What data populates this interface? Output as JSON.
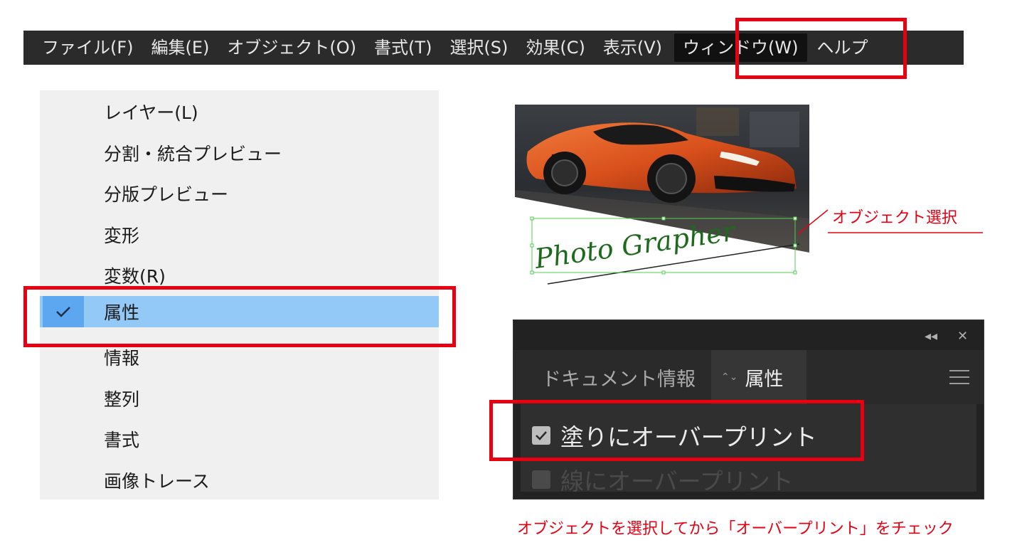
{
  "menubar": {
    "items": [
      "ファイル(F)",
      "編集(E)",
      "オブジェクト(O)",
      "書式(T)",
      "選択(S)",
      "効果(C)",
      "表示(V)",
      "ウィンドウ(W)",
      "ヘルプ"
    ],
    "active_index": 7
  },
  "window_menu": {
    "items": [
      "レイヤー(L)",
      "分割・統合プレビュー",
      "分版プレビュー",
      "変形",
      "変数(R)",
      "属性",
      "情報",
      "整列",
      "書式",
      "画像トレース"
    ],
    "checked_item": "属性",
    "check_icon": "checkmark-icon"
  },
  "artwork": {
    "photo_text": "Photo Grapher",
    "object_label": "オブジェクト選択"
  },
  "attributes_panel": {
    "collapse_glyph": "◂◂",
    "close_glyph": "✕",
    "tab_inactive": "ドキュメント情報",
    "tab_active_arrows": "⌃⌄",
    "tab_active": "属性",
    "menu_icon": "hamburger-icon",
    "overprint_fill": {
      "label": "塗りにオーバープリント",
      "checked": true
    },
    "overprint_stroke": {
      "label": "線にオーバープリント",
      "checked": false
    }
  },
  "footnote": "オブジェクトを選択してから「オーバープリント」をチェック",
  "colors": {
    "highlight": "#e60012",
    "menubar_bg": "#2b2b2b",
    "dropdown_bg": "#f0f0f0",
    "checked_row": "#93c9f7",
    "checked_cell": "#5ca7f0",
    "panel_bg": "#222222",
    "script_green": "#1d6a1d"
  }
}
